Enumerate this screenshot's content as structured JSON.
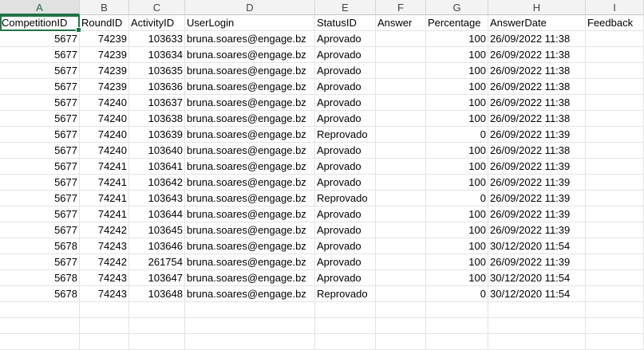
{
  "columns": [
    "A",
    "B",
    "C",
    "D",
    "E",
    "F",
    "G",
    "H",
    "I"
  ],
  "header_row": [
    "CompetitionID",
    "RoundID",
    "ActivityID",
    "UserLogin",
    "StatusID",
    "Answer",
    "Percentage",
    "AnswerDate",
    "Feedback"
  ],
  "rows": [
    [
      "5677",
      "74239",
      "103633",
      "bruna.soares@engage.bz",
      "Aprovado",
      "",
      "100",
      "26/09/2022 11:38",
      ""
    ],
    [
      "5677",
      "74239",
      "103634",
      "bruna.soares@engage.bz",
      "Aprovado",
      "",
      "100",
      "26/09/2022 11:38",
      ""
    ],
    [
      "5677",
      "74239",
      "103635",
      "bruna.soares@engage.bz",
      "Aprovado",
      "",
      "100",
      "26/09/2022 11:38",
      ""
    ],
    [
      "5677",
      "74239",
      "103636",
      "bruna.soares@engage.bz",
      "Aprovado",
      "",
      "100",
      "26/09/2022 11:38",
      ""
    ],
    [
      "5677",
      "74240",
      "103637",
      "bruna.soares@engage.bz",
      "Aprovado",
      "",
      "100",
      "26/09/2022 11:38",
      ""
    ],
    [
      "5677",
      "74240",
      "103638",
      "bruna.soares@engage.bz",
      "Aprovado",
      "",
      "100",
      "26/09/2022 11:38",
      ""
    ],
    [
      "5677",
      "74240",
      "103639",
      "bruna.soares@engage.bz",
      "Reprovado",
      "",
      "0",
      "26/09/2022 11:39",
      ""
    ],
    [
      "5677",
      "74240",
      "103640",
      "bruna.soares@engage.bz",
      "Aprovado",
      "",
      "100",
      "26/09/2022 11:38",
      ""
    ],
    [
      "5677",
      "74241",
      "103641",
      "bruna.soares@engage.bz",
      "Aprovado",
      "",
      "100",
      "26/09/2022 11:39",
      ""
    ],
    [
      "5677",
      "74241",
      "103642",
      "bruna.soares@engage.bz",
      "Aprovado",
      "",
      "100",
      "26/09/2022 11:39",
      ""
    ],
    [
      "5677",
      "74241",
      "103643",
      "bruna.soares@engage.bz",
      "Reprovado",
      "",
      "0",
      "26/09/2022 11:39",
      ""
    ],
    [
      "5677",
      "74241",
      "103644",
      "bruna.soares@engage.bz",
      "Aprovado",
      "",
      "100",
      "26/09/2022 11:39",
      ""
    ],
    [
      "5677",
      "74242",
      "103645",
      "bruna.soares@engage.bz",
      "Aprovado",
      "",
      "100",
      "26/09/2022 11:39",
      ""
    ],
    [
      "5678",
      "74243",
      "103646",
      "bruna.soares@engage.bz",
      "Aprovado",
      "",
      "100",
      "30/12/2020 11:54",
      ""
    ],
    [
      "5677",
      "74242",
      "261754",
      "bruna.soares@engage.bz",
      "Aprovado",
      "",
      "100",
      "26/09/2022 11:39",
      ""
    ],
    [
      "5678",
      "74243",
      "103647",
      "bruna.soares@engage.bz",
      "Aprovado",
      "",
      "100",
      "30/12/2020 11:54",
      ""
    ],
    [
      "5678",
      "74243",
      "103648",
      "bruna.soares@engage.bz",
      "Reprovado",
      "",
      "0",
      "30/12/2020 11:54",
      ""
    ]
  ],
  "numeric_columns": [
    0,
    1,
    2,
    6
  ],
  "selected_column": "A",
  "colors": {
    "accent": "#217346"
  }
}
